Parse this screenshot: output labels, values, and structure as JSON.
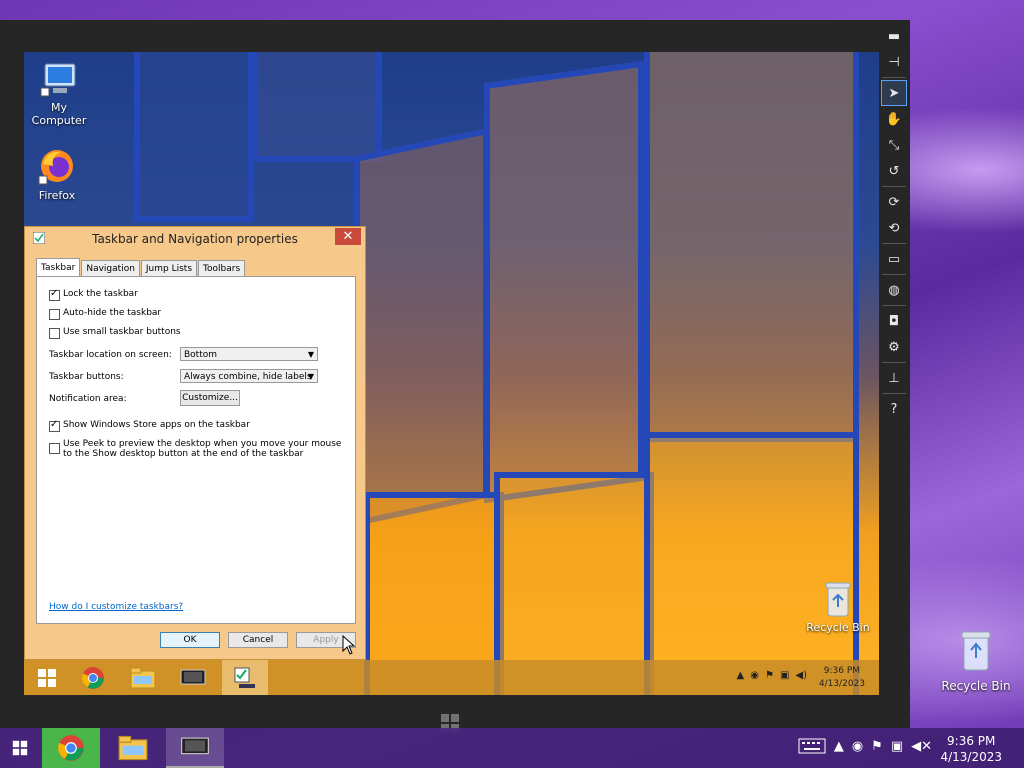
{
  "host": {
    "desktop_icons": {
      "recycle_bin": "Recycle Bin"
    },
    "taskbar": {
      "apps": [
        "start",
        "chrome",
        "file-explorer",
        "remote-viewer"
      ],
      "clock_time": "9:36 PM",
      "clock_date": "4/13/2023"
    }
  },
  "viewer": {
    "toolbar": [
      "minimize",
      "pin",
      "pointer",
      "hand",
      "resize",
      "refresh-view",
      "rotate-cw",
      "rotate-ccw",
      "monitor",
      "globe",
      "camera",
      "gear",
      "keyboard-bar",
      "help"
    ],
    "help_label": "?"
  },
  "remote": {
    "desktop_icons": {
      "my_computer": "My Computer",
      "firefox": "Firefox",
      "recycle_bin": "Recycle Bin"
    },
    "taskbar": {
      "clock_time": "9:36 PM",
      "clock_date": "4/13/2023"
    }
  },
  "dialog": {
    "title": "Taskbar and Navigation properties",
    "close": "✕",
    "tabs": [
      "Taskbar",
      "Navigation",
      "Jump Lists",
      "Toolbars"
    ],
    "options": {
      "lock": "Lock the taskbar",
      "autohide": "Auto-hide the taskbar",
      "small": "Use small taskbar buttons",
      "store": "Show Windows Store apps on the taskbar",
      "peek": "Use Peek to preview the desktop when you move your mouse to the Show desktop button at the end of the taskbar"
    },
    "location_label": "Taskbar location on screen:",
    "location_value": "Bottom",
    "buttons_label": "Taskbar buttons:",
    "buttons_value": "Always combine, hide labels",
    "notify_label": "Notification area:",
    "customize": "Customize...",
    "help_link": "How do I customize taskbars?",
    "ok": "OK",
    "cancel": "Cancel",
    "apply": "Apply"
  }
}
